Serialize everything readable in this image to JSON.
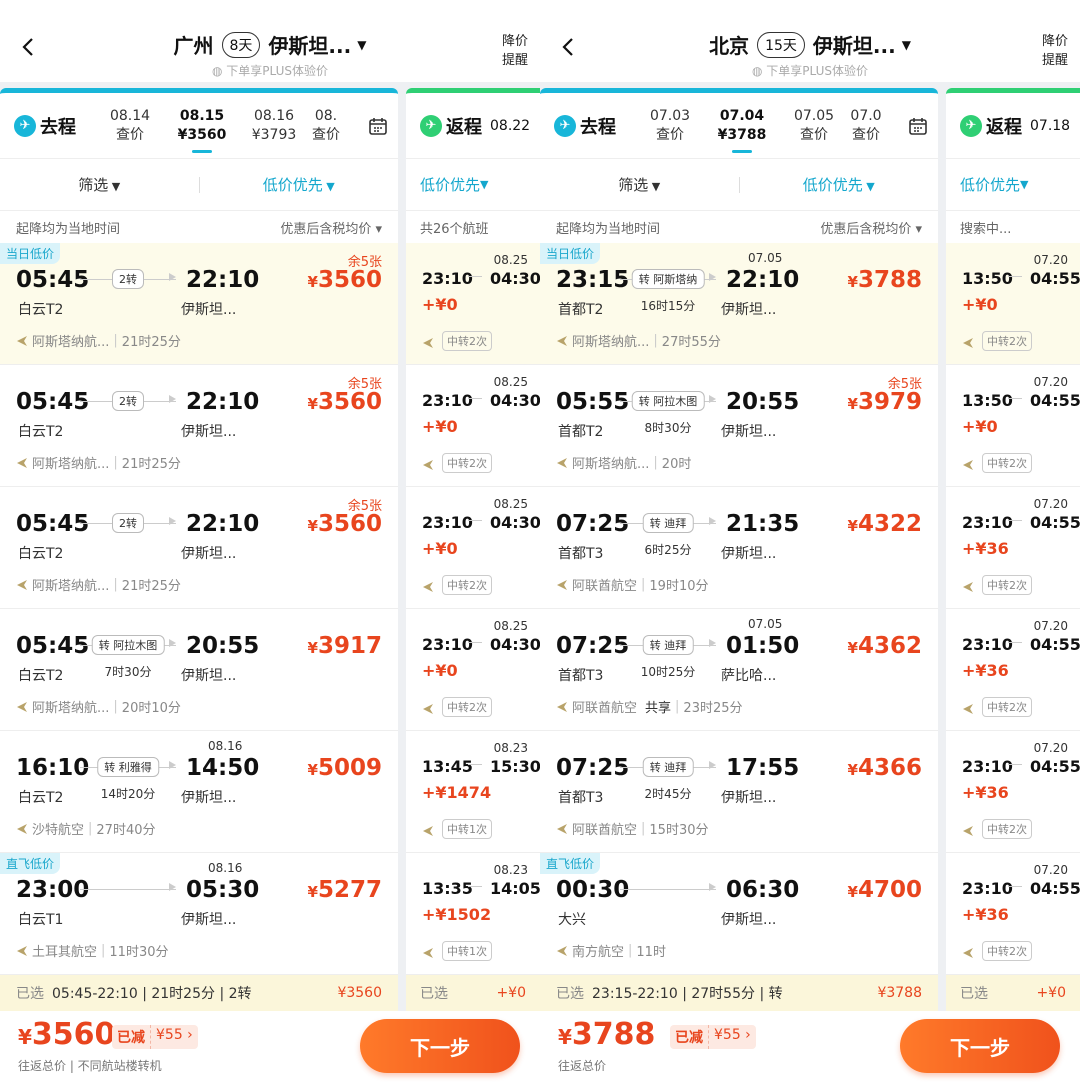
{
  "colors": {
    "accent": "#18b6d9",
    "green": "#2fcf74",
    "price": "#e8451e"
  },
  "panels": [
    {
      "origin": "广州",
      "days": "8天",
      "dest": "伊斯坦...",
      "plus_note": "下单享PLUS体验价",
      "alert": "降价 提醒",
      "alert_l1": "降价",
      "alert_l2": "提醒",
      "outbound_label": "去程",
      "return_label": "返程",
      "return_date": "08.22",
      "dates": [
        {
          "d": "08.14",
          "p": "查价"
        },
        {
          "d": "08.15",
          "p": "¥3560"
        },
        {
          "d": "08.16",
          "p": "¥3793"
        },
        {
          "d": "08.",
          "p": "查价"
        }
      ],
      "filter": "筛选",
      "sort": "低价优先",
      "return_sort": "低价优先",
      "sub_left": "起降均为当地时间",
      "sub_right": "优惠后含税均价",
      "return_sub": "共26个航班",
      "flights": [
        {
          "tag": "当日低价",
          "dep": "05:45",
          "dep_ap": "白云T2",
          "stop": "2转",
          "dur": "",
          "arr": "22:10",
          "arr_ap": "伊斯坦...",
          "nd": "",
          "price": "3560",
          "left": "余5张",
          "airline": "阿斯塔纳航...",
          "share": "",
          "time": "21时25分"
        },
        {
          "tag": "",
          "dep": "05:45",
          "dep_ap": "白云T2",
          "stop": "2转",
          "dur": "",
          "arr": "22:10",
          "arr_ap": "伊斯坦...",
          "nd": "",
          "price": "3560",
          "left": "余5张",
          "airline": "阿斯塔纳航...",
          "share": "",
          "time": "21时25分"
        },
        {
          "tag": "",
          "dep": "05:45",
          "dep_ap": "白云T2",
          "stop": "2转",
          "dur": "",
          "arr": "22:10",
          "arr_ap": "伊斯坦...",
          "nd": "",
          "price": "3560",
          "left": "余5张",
          "airline": "阿斯塔纳航...",
          "share": "",
          "time": "21时25分"
        },
        {
          "tag": "",
          "dep": "05:45",
          "dep_ap": "白云T2",
          "stop": "转 阿拉木图",
          "dur": "7时30分",
          "arr": "20:55",
          "arr_ap": "伊斯坦...",
          "nd": "",
          "price": "3917",
          "left": "",
          "airline": "阿斯塔纳航...",
          "share": "",
          "time": "20时10分"
        },
        {
          "tag": "",
          "dep": "16:10",
          "dep_ap": "白云T2",
          "stop": "转 利雅得",
          "dur": "14时20分",
          "arr": "14:50",
          "arr_ap": "伊斯坦...",
          "nd": "08.16",
          "price": "5009",
          "left": "",
          "airline": "沙特航空",
          "share": "",
          "time": "27时40分"
        },
        {
          "tag": "直飞低价",
          "dep": "23:00",
          "dep_ap": "白云T1",
          "stop": "",
          "dur": "",
          "arr": "05:30",
          "arr_ap": "伊斯坦...",
          "nd": "08.16",
          "price": "5277",
          "left": "",
          "airline": "土耳其航空",
          "share": "",
          "time": "11时30分"
        }
      ],
      "returns": [
        {
          "dep": "23:10",
          "arr": "04:30",
          "nd": "08.25",
          "price": "+¥0",
          "stops": "中转2次"
        },
        {
          "dep": "23:10",
          "arr": "04:30",
          "nd": "08.25",
          "price": "+¥0",
          "stops": "中转2次"
        },
        {
          "dep": "23:10",
          "arr": "04:30",
          "nd": "08.25",
          "price": "+¥0",
          "stops": "中转2次"
        },
        {
          "dep": "23:10",
          "arr": "04:30",
          "nd": "08.25",
          "price": "+¥0",
          "stops": "中转2次"
        },
        {
          "dep": "13:45",
          "arr": "15:30",
          "nd": "08.23",
          "price": "+¥1474",
          "stops": "中转1次"
        },
        {
          "dep": "13:35",
          "arr": "14:05",
          "nd": "08.23",
          "price": "+¥1502",
          "stops": "中转1次"
        }
      ],
      "selected": "已选",
      "selected_info": "05:45-22:10 | 21时25分 | 2转",
      "selected_price": "¥3560",
      "return_selected": "已选",
      "return_selected_price": "+¥0",
      "total": "3560",
      "discount_label": "已减",
      "discount": "¥55",
      "foot_note": "往返总价 | 不同航站楼转机",
      "next": "下一步"
    },
    {
      "origin": "北京",
      "days": "15天",
      "dest": "伊斯坦...",
      "plus_note": "下单享PLUS体验价",
      "alert_l1": "降价",
      "alert_l2": "提醒",
      "outbound_label": "去程",
      "return_label": "返程",
      "return_date": "07.18",
      "dates": [
        {
          "d": "07.03",
          "p": "查价"
        },
        {
          "d": "07.04",
          "p": "¥3788"
        },
        {
          "d": "07.05",
          "p": "查价"
        },
        {
          "d": "07.0",
          "p": "查价"
        }
      ],
      "filter": "筛选",
      "sort": "低价优先",
      "return_sort": "低价优先",
      "sub_left": "起降均为当地时间",
      "sub_right": "优惠后含税均价",
      "return_sub": "搜索中...",
      "flights": [
        {
          "tag": "当日低价",
          "dep": "23:15",
          "dep_ap": "首都T2",
          "stop": "转 阿斯塔纳",
          "dur": "16时15分",
          "arr": "22:10",
          "arr_ap": "伊斯坦...",
          "nd": "07.05",
          "price": "3788",
          "left": "",
          "airline": "阿斯塔纳航...",
          "share": "",
          "time": "27时55分"
        },
        {
          "tag": "",
          "dep": "05:55",
          "dep_ap": "首都T2",
          "stop": "转 阿拉木图",
          "dur": "8时30分",
          "arr": "20:55",
          "arr_ap": "伊斯坦...",
          "nd": "",
          "price": "3979",
          "left": "余5张",
          "airline": "阿斯塔纳航...",
          "share": "",
          "time": "20时"
        },
        {
          "tag": "",
          "dep": "07:25",
          "dep_ap": "首都T3",
          "stop": "转 迪拜",
          "dur": "6时25分",
          "arr": "21:35",
          "arr_ap": "伊斯坦...",
          "nd": "",
          "price": "4322",
          "left": "",
          "airline": "阿联酋航空",
          "share": "",
          "time": "19时10分"
        },
        {
          "tag": "",
          "dep": "07:25",
          "dep_ap": "首都T3",
          "stop": "转 迪拜",
          "dur": "10时25分",
          "arr": "01:50",
          "arr_ap": "萨比哈...",
          "nd": "07.05",
          "price": "4362",
          "left": "",
          "airline": "阿联酋航空",
          "share": "共享",
          "time": "23时25分"
        },
        {
          "tag": "",
          "dep": "07:25",
          "dep_ap": "首都T3",
          "stop": "转 迪拜",
          "dur": "2时45分",
          "arr": "17:55",
          "arr_ap": "伊斯坦...",
          "nd": "",
          "price": "4366",
          "left": "",
          "airline": "阿联酋航空",
          "share": "",
          "time": "15时30分"
        },
        {
          "tag": "直飞低价",
          "dep": "00:30",
          "dep_ap": "大兴",
          "stop": "",
          "dur": "",
          "arr": "06:30",
          "arr_ap": "伊斯坦...",
          "nd": "",
          "price": "4700",
          "left": "",
          "airline": "南方航空",
          "share": "",
          "time": "11时"
        }
      ],
      "returns": [
        {
          "dep": "13:50",
          "arr": "04:55",
          "nd": "07.20",
          "price": "+¥0",
          "stops": "中转2次"
        },
        {
          "dep": "13:50",
          "arr": "04:55",
          "nd": "07.20",
          "price": "+¥0",
          "stops": "中转2次"
        },
        {
          "dep": "23:10",
          "arr": "04:55",
          "nd": "07.20",
          "price": "+¥36",
          "stops": "中转2次"
        },
        {
          "dep": "23:10",
          "arr": "04:55",
          "nd": "07.20",
          "price": "+¥36",
          "stops": "中转2次"
        },
        {
          "dep": "23:10",
          "arr": "04:55",
          "nd": "07.20",
          "price": "+¥36",
          "stops": "中转2次"
        },
        {
          "dep": "23:10",
          "arr": "04:55",
          "nd": "07.20",
          "price": "+¥36",
          "stops": "中转2次"
        }
      ],
      "selected": "已选",
      "selected_info": "23:15-22:10 | 27时55分 | 转",
      "selected_price": "¥3788",
      "return_selected": "已选",
      "return_selected_price": "+¥0",
      "total": "3788",
      "discount_label": "已减",
      "discount": "¥55",
      "foot_note": "往返总价",
      "next": "下一步"
    }
  ]
}
